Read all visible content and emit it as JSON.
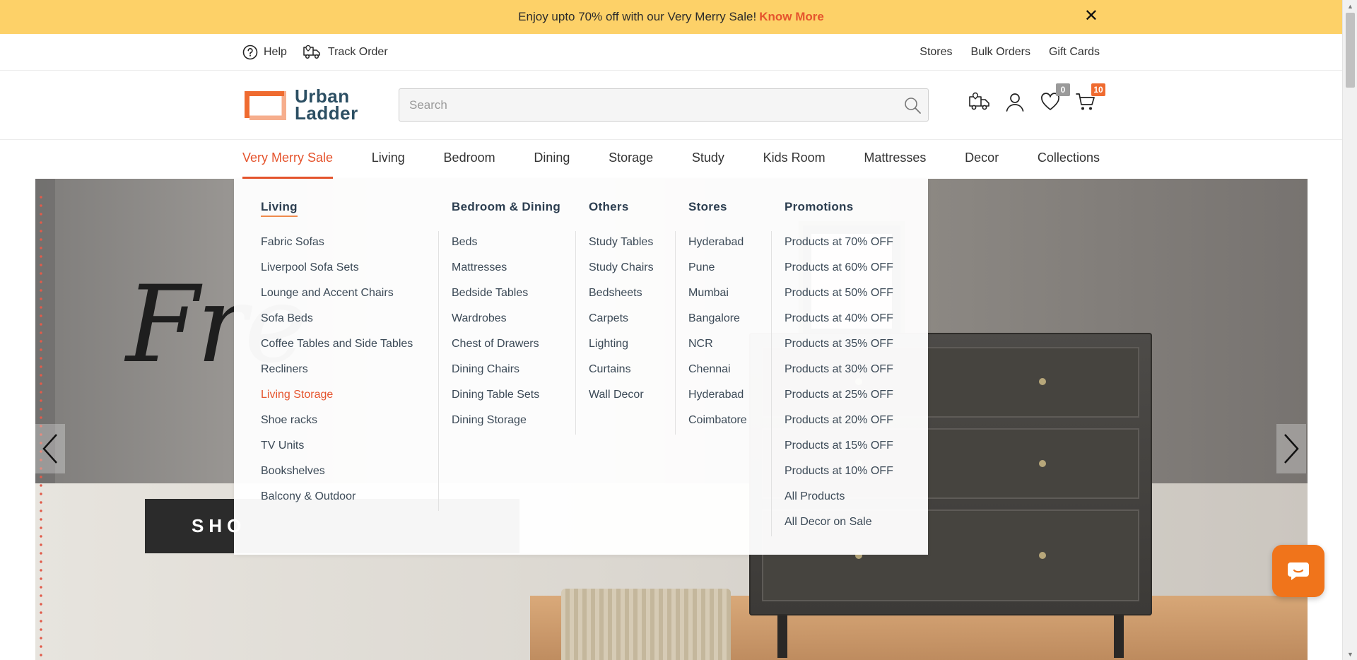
{
  "promo": {
    "text": "Enjoy upto 70% off with our Very Merry Sale!",
    "link": "Know More",
    "close": "✕"
  },
  "utility": {
    "left": [
      {
        "label": "Help",
        "icon": "help-circle-icon"
      },
      {
        "label": "Track Order",
        "icon": "truck-icon"
      }
    ],
    "right": [
      "Stores",
      "Bulk Orders",
      "Gift Cards"
    ]
  },
  "brand": {
    "line1": "Urban",
    "line2": "Ladder",
    "accent": "#ef6b30",
    "text_color": "#2c4f63"
  },
  "search": {
    "placeholder": "Search",
    "value": ""
  },
  "header_icons": {
    "wishlist_count": "0",
    "cart_count": "10"
  },
  "nav": [
    "Very Merry Sale",
    "Living",
    "Bedroom",
    "Dining",
    "Storage",
    "Study",
    "Kids Room",
    "Mattresses",
    "Decor",
    "Collections"
  ],
  "mega": {
    "living": {
      "title": "Living",
      "items": [
        "Fabric Sofas",
        "Liverpool Sofa Sets",
        "Lounge and Accent Chairs",
        "Sofa Beds",
        "Coffee Tables and Side Tables",
        "Recliners",
        "Living Storage",
        "Shoe racks",
        "TV Units",
        "Bookshelves",
        "Balcony & Outdoor"
      ]
    },
    "bedroom": {
      "title": "Bedroom & Dining",
      "items": [
        "Beds",
        "Mattresses",
        "Bedside Tables",
        "Wardrobes",
        "Chest of Drawers",
        "Dining Chairs",
        "Dining Table Sets",
        "Dining Storage"
      ]
    },
    "others": {
      "title": "Others",
      "items": [
        "Study Tables",
        "Study Chairs",
        "Bedsheets",
        "Carpets",
        "Lighting",
        "Curtains",
        "Wall Decor"
      ]
    },
    "stores": {
      "title": "Stores",
      "items": [
        "Hyderabad",
        "Pune",
        "Mumbai",
        "Bangalore",
        "NCR",
        "Chennai",
        "Hyderabad",
        "Coimbatore"
      ]
    },
    "promotions": {
      "title": "Promotions",
      "items": [
        "Products at 70% OFF",
        "Products at 60% OFF",
        "Products at 50% OFF",
        "Products at 40% OFF",
        "Products at 35% OFF",
        "Products at 30% OFF",
        "Products at 25% OFF",
        "Products at 20% OFF",
        "Products at 15% OFF",
        "Products at 10% OFF",
        "All Products",
        "All Decor on Sale"
      ]
    }
  },
  "hero": {
    "script_text": "Fre",
    "cta": "SHO"
  },
  "colors": {
    "promo_bg": "#fdd168",
    "accent": "#e5542d",
    "chat": "#f0741b"
  }
}
